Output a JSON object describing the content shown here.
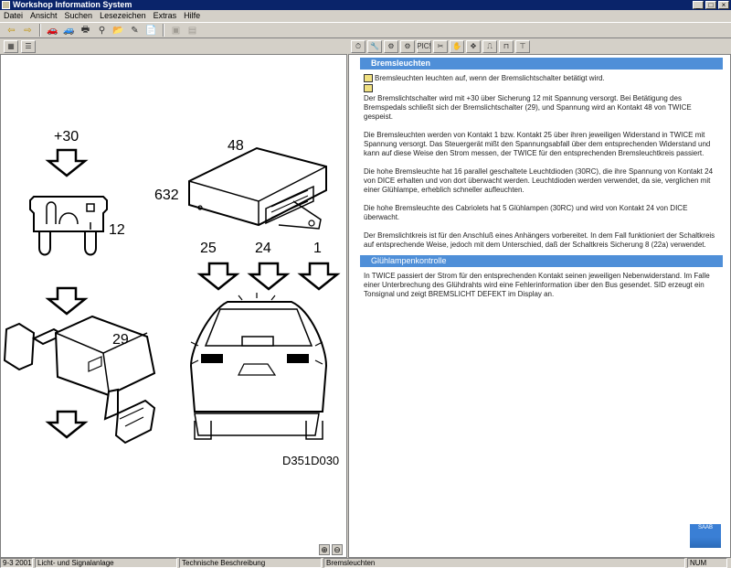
{
  "window": {
    "title": "Workshop Information System"
  },
  "menu": [
    "Datei",
    "Ansicht",
    "Suchen",
    "Lesezeichen",
    "Extras",
    "Hilfe"
  ],
  "toolbar": {
    "icons": [
      "arrow-left-icon",
      "arrow-right-icon",
      "car-icon",
      "car-2-icon",
      "print-icon",
      "binoculars-icon",
      "folder-icon",
      "pencil-icon",
      "document-icon",
      "picture-icon",
      "film-icon"
    ]
  },
  "right_toolbar": {
    "pic_label": "PIC!"
  },
  "diagram": {
    "labels": {
      "plus30": "+30",
      "n12": "12",
      "n48": "48",
      "n632": "632",
      "n25": "25",
      "n24": "24",
      "n1": "1",
      "n29": "29",
      "code": "D351D030"
    }
  },
  "document": {
    "section1_title": "Bremsleuchten",
    "intro": "Bremsleuchten leuchten auf, wenn der Bremslichtschalter betätigt wird.",
    "p1": "Der Bremslichtschalter wird mit +30 über Sicherung 12 mit Spannung versorgt. Bei Betätigung des Bremspedals schließt sich der Bremslichtschalter (29), und Spannung wird an Kontakt 48 von TWICE gespeist.",
    "p2": "Die Bremsleuchten werden von Kontakt 1 bzw. Kontakt 25 über ihren jeweiligen Widerstand in TWICE mit Spannung versorgt. Das Steuergerät mißt den Spannungsabfall über dem entsprechenden Widerstand und kann auf diese Weise den Strom messen, der TWICE für den entsprechenden Bremsleuchtkreis passiert.",
    "p3": "Die hohe Bremsleuchte hat 16 parallel geschaltete Leuchtdioden (30RC), die ihre Spannung von Kontakt 24 von DICE erhalten und von dort überwacht werden. Leuchtdioden werden verwendet, da sie, verglichen mit einer Glühlampe, erheblich schneller aufleuchten.",
    "p4": "Die hohe Bremsleuchte des Cabriolets hat 5 Glühlampen (30RC) und wird von Kontakt 24 von DICE überwacht.",
    "p5": "Der Bremslichtkreis ist für den Anschluß eines Anhängers vorbereitet. In dem Fall funktioniert der Schaltkreis auf entsprechende Weise, jedoch mit dem Unterschied, daß der Schaltkreis Sicherung 8 (22a) verwendet.",
    "section2_title": "Glühlampenkontrolle",
    "p6": "In TWICE passiert der Strom für den entsprechenden Kontakt seinen jeweiligen Nebenwiderstand. Im Falle einer Unterbrechung des Glühdrahts wird eine Fehlerinformation über den Bus gesendet. SID erzeugt ein Tonsignal und zeigt BREMSLICHT DEFEKT im Display an."
  },
  "logo_text": "SAAB",
  "statusbar": {
    "model": "9-3 2001",
    "system": "Licht- und Signalanlage",
    "doctype": "Technische Beschreibung",
    "topic": "Bremsleuchten",
    "num": "NUM"
  }
}
